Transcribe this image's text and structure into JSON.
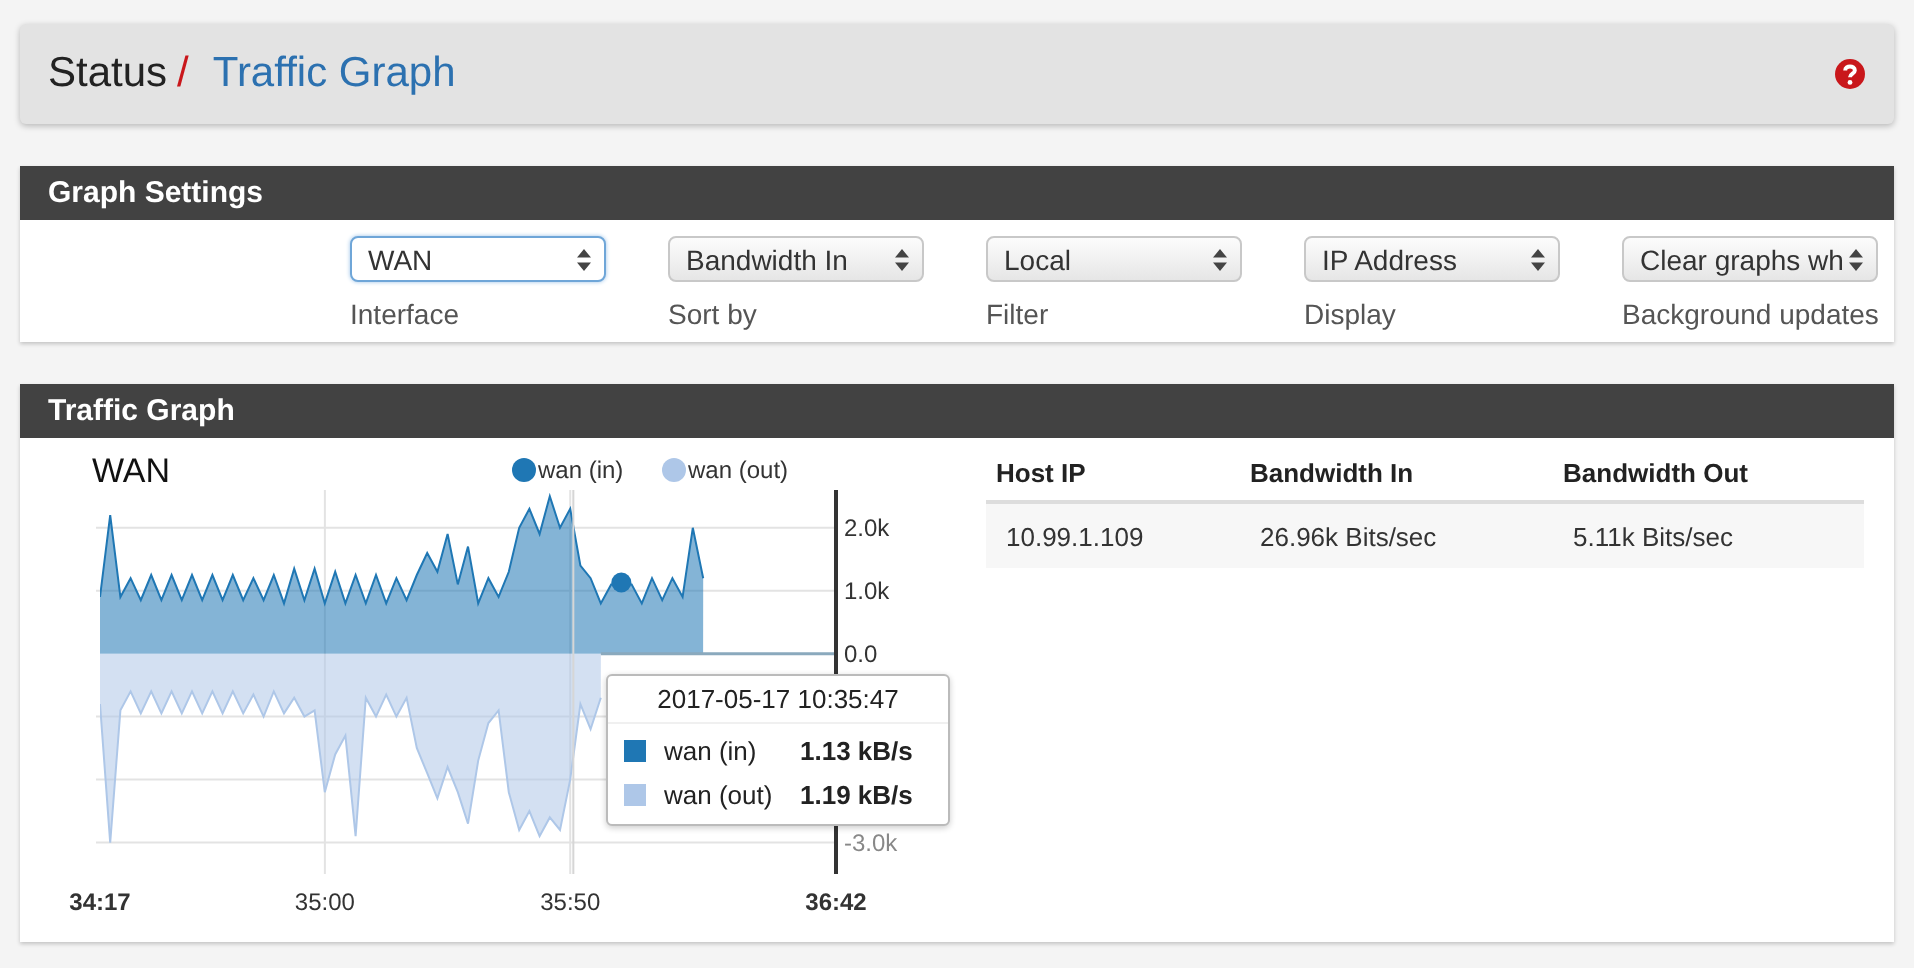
{
  "breadcrumb": {
    "parent": "Status",
    "separator": "/",
    "current": "Traffic Graph"
  },
  "settings": {
    "title": "Graph Settings",
    "fields": [
      {
        "value": "WAN",
        "label": "Interface",
        "focused": true
      },
      {
        "value": "Bandwidth In",
        "label": "Sort by",
        "focused": false
      },
      {
        "value": "Local",
        "label": "Filter",
        "focused": false
      },
      {
        "value": "IP Address",
        "label": "Display",
        "focused": false
      },
      {
        "value": "Clear graphs wh",
        "label": "Background updates",
        "focused": false
      }
    ]
  },
  "traffic": {
    "title": "Traffic Graph",
    "graph_title": "WAN",
    "chart_data": {
      "type": "area",
      "ylim": [
        -3500,
        2600
      ],
      "grid": true,
      "legend": true,
      "yticks": [
        {
          "value": 2000,
          "label": "2.0k"
        },
        {
          "value": 1000,
          "label": "1.0k"
        },
        {
          "value": 0,
          "label": "0.0"
        },
        {
          "value": -3000,
          "label": "-3.0k"
        }
      ],
      "categories": [
        "34:17",
        null,
        null,
        null,
        null,
        null,
        null,
        null,
        null,
        null,
        null,
        null,
        null,
        null,
        null,
        null,
        null,
        null,
        null,
        null,
        null,
        null,
        "35:00",
        null,
        null,
        null,
        null,
        null,
        null,
        null,
        null,
        null,
        null,
        null,
        null,
        null,
        null,
        null,
        null,
        null,
        null,
        null,
        null,
        null,
        null,
        null,
        "35:50",
        null,
        null,
        null,
        null,
        null,
        null,
        null,
        null,
        null,
        null,
        null,
        null,
        null,
        null,
        null,
        null,
        null,
        null,
        null,
        null,
        null,
        null,
        null,
        null,
        null,
        "36:42"
      ],
      "series": [
        {
          "name": "wan (in)",
          "color": "#1f77b4",
          "values": [
            900,
            2200,
            900,
            1200,
            850,
            1250,
            850,
            1250,
            850,
            1250,
            850,
            1250,
            850,
            1250,
            850,
            1200,
            850,
            1250,
            800,
            1350,
            850,
            1350,
            800,
            1300,
            800,
            1250,
            800,
            1250,
            800,
            1200,
            850,
            1250,
            1600,
            1300,
            1900,
            1100,
            1700,
            800,
            1200,
            900,
            1300,
            2000,
            2300,
            1900,
            2500,
            2000,
            2300,
            1400,
            1200,
            800,
            1100,
            1130,
            1100,
            800,
            1200,
            850,
            1200,
            900,
            2000,
            1200,
            null,
            null,
            null,
            null,
            null,
            null,
            null,
            null,
            null,
            null,
            null,
            null,
            null
          ]
        },
        {
          "name": "wan (out)",
          "color": "#aec7e8",
          "values": [
            -800,
            -3000,
            -900,
            -600,
            -950,
            -600,
            -950,
            -600,
            -950,
            -600,
            -950,
            -600,
            -950,
            -600,
            -950,
            -650,
            -1000,
            -600,
            -950,
            -700,
            -1000,
            -900,
            -2200,
            -1600,
            -1300,
            -2900,
            -700,
            -1000,
            -650,
            -1000,
            -700,
            -1500,
            -1900,
            -2300,
            -1800,
            -2200,
            -2700,
            -1700,
            -1100,
            -900,
            -2200,
            -2800,
            -2500,
            -2900,
            -2600,
            -2800,
            -2000,
            -800,
            -1200,
            -700,
            null,
            null,
            null,
            null,
            null,
            null,
            null,
            null,
            null,
            null,
            null,
            null,
            null,
            null,
            null,
            null,
            null,
            null,
            null,
            null,
            null,
            null,
            null
          ]
        }
      ]
    },
    "tooltip": {
      "title": "2017-05-17 10:35:47",
      "rows": [
        {
          "label": "wan (in)",
          "value": "1.13 kB/s",
          "color": "#1f77b4"
        },
        {
          "label": "wan (out)",
          "value": "1.19 kB/s",
          "color": "#aec7e8"
        }
      ]
    },
    "table": {
      "columns": [
        "Host IP",
        "Bandwidth In",
        "Bandwidth Out"
      ],
      "rows": [
        [
          "10.99.1.109",
          "26.96k Bits/sec",
          "5.11k Bits/sec"
        ]
      ]
    }
  }
}
